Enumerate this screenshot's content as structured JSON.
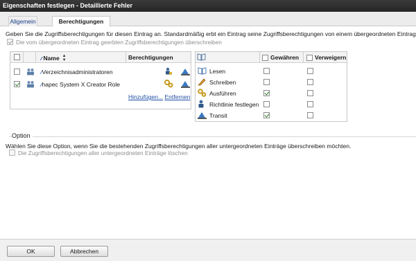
{
  "window": {
    "title": "Eigenschaften festlegen - Detaillierte Fehler"
  },
  "tabs": [
    {
      "label": "Allgemein",
      "active": false
    },
    {
      "label": "Berechtigungen",
      "active": true
    }
  ],
  "description": "Geben Sie die Zugriffsberechtigungen für diesen Eintrag an. Standardmäßig erbt ein Eintrag seine Zugriffsberechtigungen von einem übergeordneten Eintrag.",
  "inherit": {
    "label": "Die vom übergeordneten Eintrag geerbten Zugriffsberechtigungen überschreiben",
    "checked": true,
    "enabled": false
  },
  "left_table": {
    "columns": {
      "name": "Name",
      "permissions": "Berechtigungen"
    },
    "rows": [
      {
        "name": "Verzeichnisadministratoren",
        "checked": false,
        "icon": "group-icon"
      },
      {
        "name": "hapec System X Creator Role",
        "checked": true,
        "icon": "group-icon"
      }
    ],
    "add_link": "Hinzufügen...",
    "remove_link": "Entfernen"
  },
  "right_table": {
    "columns": {
      "grant": "Gewähren",
      "deny": "Verweigern"
    },
    "rows": [
      {
        "label": "Lesen",
        "icon": "read-icon",
        "grant": false,
        "deny": false
      },
      {
        "label": "Schreiben",
        "icon": "pencil-icon",
        "grant": false,
        "deny": false
      },
      {
        "label": "Ausführen",
        "icon": "execute-icon",
        "grant": true,
        "deny": false
      },
      {
        "label": "Richtlinie festlegen",
        "icon": "policy-icon",
        "grant": false,
        "deny": false
      },
      {
        "label": "Transit",
        "icon": "transit-icon",
        "grant": true,
        "deny": false
      }
    ]
  },
  "option": {
    "title": "Option",
    "description": "Wählen Sie diese Option, wenn Sie die bestehenden Zugriffsberechtigungen aller untergeordneten Einträge überschreiben möchten.",
    "checkbox_label": "Die Zugriffsberechtigungen aller untergeordneten Einträge löschen",
    "checked": false,
    "enabled": false
  },
  "buttons": {
    "ok": "OK",
    "cancel": "Abbrechen"
  }
}
